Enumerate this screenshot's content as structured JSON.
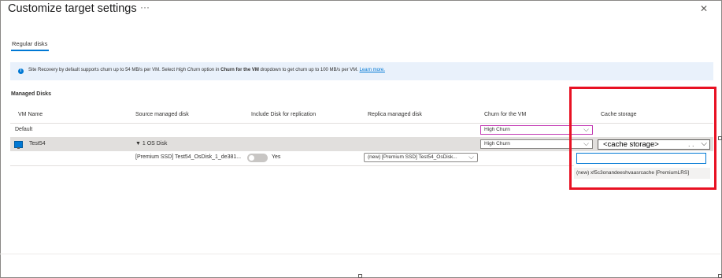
{
  "header": {
    "title": "Customize target settings",
    "more": "···",
    "close": "✕"
  },
  "tabs": [
    {
      "label": "Regular disks"
    }
  ],
  "info": {
    "t1": "Site Recovery by default supports churn up to 54 MB/s per VM. Select ",
    "em": "High Churn",
    "t2": " option in ",
    "bold": "Churn for the VM",
    "t3": " dropdown to get churn up to 100 MB/s per VM. ",
    "link": "Learn more."
  },
  "section_title": "Managed Disks",
  "columns": [
    "VM Name",
    "Source managed disk",
    "Include Disk for replication",
    "Replica managed disk",
    "Churn for the VM",
    "Cache storage"
  ],
  "rows": {
    "default": {
      "name": "Default",
      "churn": "High Churn"
    },
    "vm": {
      "name": "Test54",
      "disk_group": "▼ 1 OS Disk",
      "churn": "High Churn",
      "cache": "<cache storage>"
    },
    "disk": {
      "source": "[Premium SSD] Test54_OsDisk_1_de381...",
      "include": "Yes",
      "replica": "(new) [Premium SSD] Test54_OsDisk..."
    }
  },
  "cache_dropdown": {
    "search_value": "",
    "options": [
      "(new) xf5c3onandeeshvaasrcache [PremiumLRS]"
    ]
  },
  "colors": {
    "accent": "#0078d4",
    "highlight_border": "#e81123",
    "info_bg": "#e9f1fb",
    "selected_row": "#e1dfdd"
  }
}
